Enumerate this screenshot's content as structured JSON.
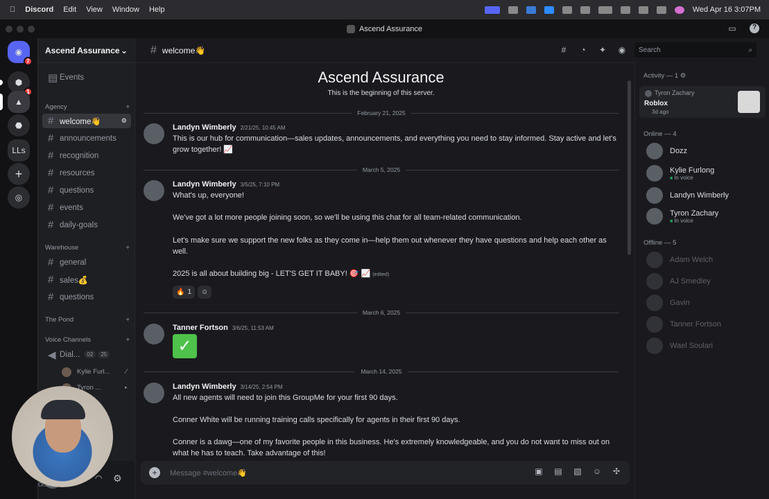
{
  "menubar": {
    "app": "Discord",
    "items": [
      "Edit",
      "View",
      "Window",
      "Help"
    ],
    "datetime": "Wed Apr 16  3:07PM"
  },
  "window": {
    "title": "Ascend Assurance"
  },
  "guilds": {
    "home_badge": "7",
    "server2_badge": "1",
    "ll_label": "LLs"
  },
  "server": {
    "name": "Ascend Assurance",
    "events": "Events",
    "categories": [
      "Agency",
      "Warehouse",
      "The Pond",
      "Voice Channels"
    ],
    "agency_channels": [
      "welcome👋",
      "announcements",
      "recognition",
      "resources",
      "questions",
      "events",
      "daily-goals"
    ],
    "warehouse_channels": [
      "general",
      "sales💰",
      "questions"
    ],
    "voice_channel": "Dial...",
    "voice_count_video": "02",
    "voice_count_users": "25",
    "voice_users": [
      "Kylie Furl...",
      "Tyron ..."
    ]
  },
  "user": {
    "status": "Online"
  },
  "channel": {
    "name": "welcome👋",
    "search_placeholder": "Search",
    "composer_placeholder": "Message #welcome👋"
  },
  "welcome": {
    "title": "Ascend Assurance",
    "subtitle": "This is the beginning of this server."
  },
  "messages": [
    {
      "date": "February 21, 2025",
      "author": "Landyn Wimberly",
      "timestamp": "2/21/25, 10:45 AM",
      "lines": [
        "This is our hub for communication—sales updates, announcements, and everything you need to stay informed. Stay active and let's grow together! 📈"
      ]
    },
    {
      "date": "March 5, 2025",
      "author": "Landyn Wimberly",
      "timestamp": "3/5/25, 7:10 PM",
      "lines": [
        "What's up, everyone!",
        "We've got a lot more people joining soon, so we'll be using this chat for all team-related communication.",
        "Let's make sure we support the new folks as they come in—help them out whenever they have questions and help each other as well.",
        "2025 is all about building big - LET'S GET IT BABY! 🎯 📈"
      ],
      "edited": "(edited)",
      "reaction": "🔥",
      "reaction_count": "1"
    },
    {
      "date": "March 6, 2025",
      "author": "Tanner Fortson",
      "timestamp": "3/6/25, 11:53 AM",
      "check": "✓"
    },
    {
      "date": "March 14, 2025",
      "author": "Landyn Wimberly",
      "timestamp": "3/14/25, 2:54 PM",
      "lines": [
        "All new agents will need to join this GroupMe for your first 90 days.",
        "Conner White will be running training calls specifically for agents in their first 90 days.",
        "Conner is a dawg—one of my favorite people in this business. He's extremely knowledgeable, and you do not want to miss out on what he has to teach. Take advantage of this!"
      ]
    }
  ],
  "members": {
    "activity_label": "Activity — 1",
    "activity": {
      "user": "Tyron Zachary",
      "game": "Roblox",
      "time": "3d ago"
    },
    "online_label": "Online — 4",
    "online": [
      {
        "name": "Dozz",
        "status": ""
      },
      {
        "name": "Kylie Furlong",
        "status": "In voice"
      },
      {
        "name": "Landyn Wimberly",
        "status": ""
      },
      {
        "name": "Tyron Zachary",
        "status": "In voice"
      }
    ],
    "offline_label": "Offline — 5",
    "offline": [
      "Adam Welch",
      "AJ Smedley",
      "Gavin",
      "Tanner Fortson",
      "Wael Soulari"
    ]
  }
}
